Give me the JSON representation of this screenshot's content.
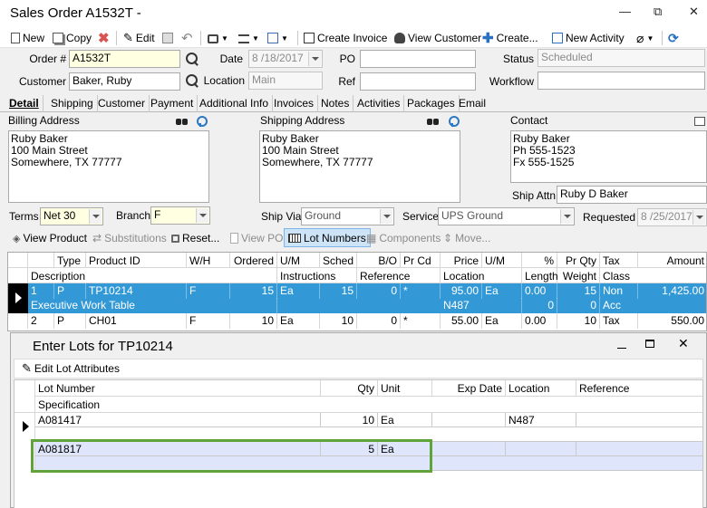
{
  "window": {
    "title": "Sales Order A1532T -",
    "minimize": "—",
    "restore": "⧉",
    "close": "✕"
  },
  "toolbar": {
    "new": "New",
    "copy": "Copy",
    "edit": "Edit",
    "create_invoice": "Create Invoice",
    "view_customer": "View Customer",
    "create": "Create...",
    "new_activity": "New Activity"
  },
  "form": {
    "order_label": "Order #",
    "order_value": "A1532T",
    "date_label": "Date",
    "date_value": "8 /18/2017",
    "po_label": "PO",
    "po_value": "",
    "status_label": "Status",
    "status_value": "Scheduled",
    "customer_label": "Customer",
    "customer_value": "Baker, Ruby",
    "location_label": "Location",
    "location_value": "Main",
    "ref_label": "Ref",
    "ref_value": "",
    "workflow_label": "Workflow",
    "workflow_value": ""
  },
  "tabs": [
    "Detail",
    "Shipping",
    "Customer",
    "Payment",
    "Additional Info",
    "Invoices",
    "Notes",
    "Activities",
    "Packages",
    "Email"
  ],
  "addresses": {
    "billing_label": "Billing Address",
    "billing_text": "Ruby Baker\n100 Main Street\nSomewhere, TX 77777",
    "shipping_label": "Shipping Address",
    "shipping_text": "Ruby Baker\n100 Main Street\nSomewhere, TX 77777",
    "contact_label": "Contact",
    "contact_text": "Ruby Baker\nPh 555-1523\nFx 555-1525",
    "ship_attn_label": "Ship Attn",
    "ship_attn_value": "Ruby D Baker"
  },
  "terms": {
    "terms_label": "Terms",
    "terms_value": "Net 30",
    "branch_label": "Branch",
    "branch_value": "F",
    "ship_via_label": "Ship Via",
    "ship_via_value": "Ground",
    "service_label": "Service",
    "service_value": "UPS Ground",
    "requested_label": "Requested",
    "requested_value": "8 /25/2017"
  },
  "subtoolbar": {
    "view_product": "View Product",
    "substitutions": "Substitutions",
    "reset": "Reset...",
    "view_po": "View PO",
    "lot_numbers": "Lot Numbers",
    "components": "Components",
    "move": "Move..."
  },
  "grid": {
    "header1": [
      "Type",
      "Product ID",
      "W/H",
      "Ordered",
      "U/M",
      "Sched",
      "B/O",
      "Pr Cd",
      "Price",
      "U/M",
      "%",
      "Pr Qty",
      "Tax",
      "Amount"
    ],
    "header2": [
      "Description",
      "Instructions",
      "Reference",
      "Location",
      "Length",
      "Weight",
      "Class"
    ],
    "row1": [
      "1",
      "P",
      "TP10214",
      "F",
      "15",
      "Ea",
      "15",
      "0",
      "*",
      "95.00",
      "Ea",
      "0.00",
      "15",
      "Non",
      "1,425.00"
    ],
    "row1b": [
      "Executive Work Table",
      "N487",
      "0",
      "0",
      "Acc"
    ],
    "row2": [
      "2",
      "P",
      "CH01",
      "F",
      "10",
      "Ea",
      "10",
      "0",
      "*",
      "55.00",
      "Ea",
      "0.00",
      "10",
      "Tax",
      "550.00"
    ]
  },
  "dialog": {
    "title": "Enter Lots for TP10214",
    "edit_attrs": "Edit Lot Attributes",
    "headers": [
      "Lot Number",
      "Qty",
      "Unit",
      "Exp Date",
      "Location",
      "Reference"
    ],
    "spec_header": "Specification",
    "rows": [
      {
        "lot": "A081417",
        "qty": "10",
        "unit": "Ea",
        "exp": "",
        "location": "N487",
        "reference": ""
      },
      {
        "lot": "A081817",
        "qty": "5",
        "unit": "Ea",
        "exp": "",
        "location": "",
        "reference": ""
      }
    ]
  },
  "colors": {
    "selection": "#3399d6",
    "highlight_row": "#dfe6fb",
    "callout": "#5fa33a"
  }
}
